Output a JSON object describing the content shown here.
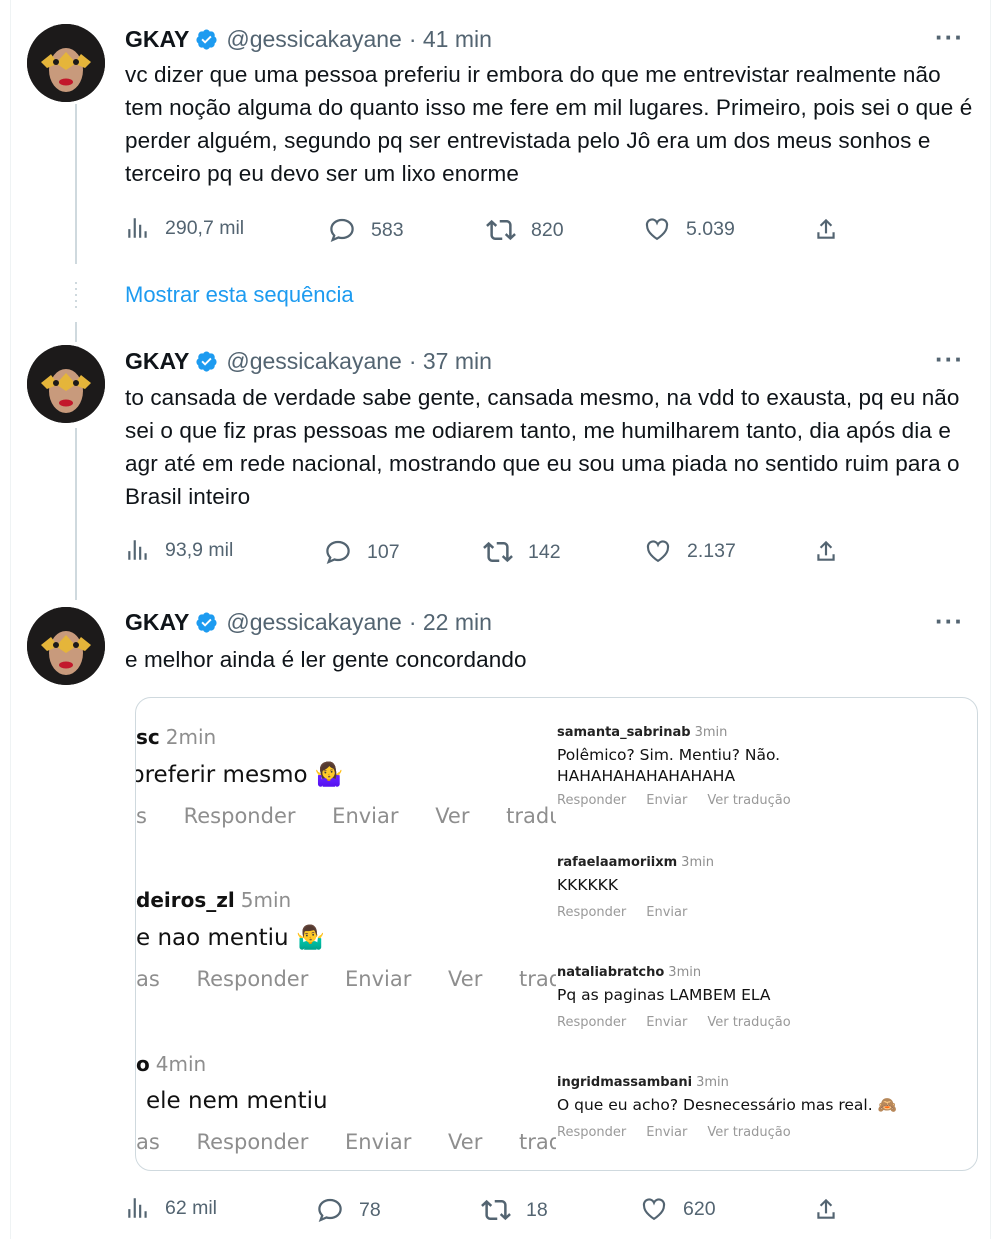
{
  "tweets": [
    {
      "name": "GKAY",
      "handle": "@gessicakayane",
      "time": "· 41 min",
      "text": "vc dizer que uma pessoa preferiu ir embora do que me entrevistar realmente não tem noção alguma do quanto isso me fere em mil lugares. Primeiro, pois sei o que é perder alguém, segundo pq ser entrevistada pelo Jô era um dos meus sonhos e terceiro pq eu devo ser um lixo enorme",
      "views": "290,7 mil",
      "replies": "583",
      "retweets": "820",
      "likes": "5.039"
    },
    {
      "name": "GKAY",
      "handle": "@gessicakayane",
      "time": "· 37 min",
      "text": "to cansada de verdade sabe gente, cansada mesmo, na vdd to exausta, pq eu não sei o que fiz pras pessoas me odiarem tanto, me humilharem tanto, dia após dia e agr até em rede nacional, mostrando que eu sou uma piada no sentido ruim para o Brasil inteiro",
      "views": "93,9 mil",
      "replies": "107",
      "retweets": "142",
      "likes": "2.137"
    },
    {
      "name": "GKAY",
      "handle": "@gessicakayane",
      "time": "· 22 min",
      "text": "e melhor ainda é ler gente concordando",
      "views": "62 mil",
      "replies": "78",
      "retweets": "18",
      "likes": "620"
    }
  ],
  "show_thread": "Mostrar esta sequência",
  "embedded_left": [
    {
      "user": "sc",
      "time": "2min",
      "comment": "preferir mesmo 🤷‍♀️",
      "meta": "s Responder Enviar Ver traduç"
    },
    {
      "user": "deiros_zl",
      "time": "5min",
      "comment": "e nao mentiu 🤷‍♂️",
      "meta": "as Responder Enviar Ver tradu"
    },
    {
      "user": "o",
      "time": "4min",
      "comment": "ele nem mentiu",
      "meta": "as Responder Enviar Ver tradu"
    }
  ],
  "embedded_right": [
    {
      "user": "samanta_sabrinab",
      "time": "3min",
      "comment_l1": "Polêmico? Sim. Mentiu? Não.",
      "comment_l2": "HAHAHAHAHAHAHAHA",
      "actions": [
        "Responder",
        "Enviar",
        "Ver tradução"
      ]
    },
    {
      "user": "rafaelaamoriixm",
      "time": "3min",
      "comment_l1": "KKKKKK",
      "comment_l2": "",
      "actions": [
        "Responder",
        "Enviar"
      ]
    },
    {
      "user": "nataliabratcho",
      "time": "3min",
      "comment_l1": "Pq as paginas LAMBEM ELA",
      "comment_l2": "",
      "actions": [
        "Responder",
        "Enviar",
        "Ver tradução"
      ]
    },
    {
      "user": "ingridmassambani",
      "time": "3min",
      "comment_l1": "O que eu acho? Desnecessário mas real. 🙈",
      "comment_l2": "",
      "actions": [
        "Responder",
        "Enviar",
        "Ver tradução"
      ]
    }
  ],
  "colors": {
    "accent": "#1d9bf0",
    "secondary_text": "#536471",
    "thread_line": "#cfd9de"
  }
}
